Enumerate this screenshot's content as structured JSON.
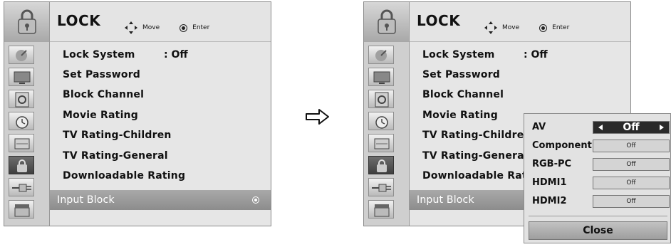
{
  "menu": {
    "title": "LOCK",
    "hint_move": "Move",
    "hint_enter": "Enter",
    "sidebar_icons": [
      "satellite-dish-icon",
      "tv-icon",
      "speaker-icon",
      "clock-icon",
      "picture-icon",
      "lock-icon",
      "input-plug-icon",
      "clapperboard-icon"
    ],
    "active_icon": "lock-icon",
    "items": [
      {
        "label": "Lock System",
        "value": ": Off"
      },
      {
        "label": "Set Password",
        "value": ""
      },
      {
        "label": "Block Channel",
        "value": ""
      },
      {
        "label": "Movie Rating",
        "value": ""
      },
      {
        "label": "TV Rating-Children",
        "value": ""
      },
      {
        "label": "TV Rating-General",
        "value": ""
      },
      {
        "label": "Downloadable Rating",
        "value": ""
      },
      {
        "label": "Input Block",
        "value": ""
      }
    ],
    "selected_item": "Input Block"
  },
  "arrow_icon": "right-arrow-icon",
  "popup": {
    "rows": [
      {
        "label": "AV",
        "value": "Off"
      },
      {
        "label": "Component",
        "value": "Off"
      },
      {
        "label": "RGB-PC",
        "value": "Off"
      },
      {
        "label": "HDMI1",
        "value": "Off"
      },
      {
        "label": "HDMI2",
        "value": "Off"
      }
    ],
    "close_label": "Close"
  },
  "colors": {
    "panel_bg": "#e6e6e6",
    "selected_row": "#9a9a9a",
    "active_value_box": "#2a2a2a"
  }
}
